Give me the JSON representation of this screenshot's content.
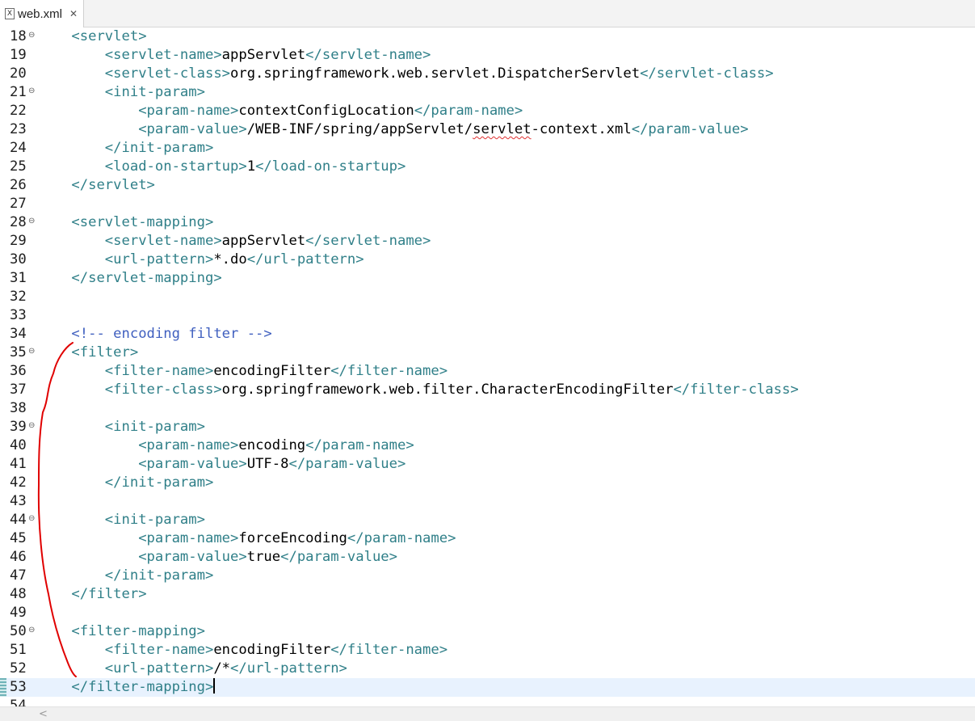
{
  "tab": {
    "filename": "web.xml",
    "icon": "xml-file-icon",
    "close": "✕"
  },
  "editor": {
    "current_line": 53,
    "lines": [
      {
        "n": "18",
        "fold": true,
        "segs": [
          [
            "sp",
            "    "
          ],
          [
            "tag",
            "<servlet>"
          ]
        ]
      },
      {
        "n": "19",
        "segs": [
          [
            "sp",
            "        "
          ],
          [
            "tag",
            "<servlet-name>"
          ],
          [
            "txt",
            "appServlet"
          ],
          [
            "tag",
            "</servlet-name>"
          ]
        ]
      },
      {
        "n": "20",
        "segs": [
          [
            "sp",
            "        "
          ],
          [
            "tag",
            "<servlet-class>"
          ],
          [
            "txt",
            "org.springframework.web.servlet.DispatcherServlet"
          ],
          [
            "tag",
            "</servlet-class>"
          ]
        ]
      },
      {
        "n": "21",
        "fold": true,
        "segs": [
          [
            "sp",
            "        "
          ],
          [
            "tag",
            "<init-param>"
          ]
        ]
      },
      {
        "n": "22",
        "segs": [
          [
            "sp",
            "            "
          ],
          [
            "tag",
            "<param-name>"
          ],
          [
            "txt",
            "contextConfigLocation"
          ],
          [
            "tag",
            "</param-name>"
          ]
        ]
      },
      {
        "n": "23",
        "segs": [
          [
            "sp",
            "            "
          ],
          [
            "tag",
            "<param-value>"
          ],
          [
            "txt",
            "/WEB-INF/spring/appServlet/"
          ],
          [
            "squig",
            "servlet"
          ],
          [
            "txt",
            "-context.xml"
          ],
          [
            "tag",
            "</param-value>"
          ]
        ]
      },
      {
        "n": "24",
        "segs": [
          [
            "sp",
            "        "
          ],
          [
            "tag",
            "</init-param>"
          ]
        ]
      },
      {
        "n": "25",
        "segs": [
          [
            "sp",
            "        "
          ],
          [
            "tag",
            "<load-on-startup>"
          ],
          [
            "txt",
            "1"
          ],
          [
            "tag",
            "</load-on-startup>"
          ]
        ]
      },
      {
        "n": "26",
        "segs": [
          [
            "sp",
            "    "
          ],
          [
            "tag",
            "</servlet>"
          ]
        ]
      },
      {
        "n": "27",
        "segs": []
      },
      {
        "n": "28",
        "fold": true,
        "segs": [
          [
            "sp",
            "    "
          ],
          [
            "tag",
            "<servlet-mapping>"
          ]
        ]
      },
      {
        "n": "29",
        "segs": [
          [
            "sp",
            "        "
          ],
          [
            "tag",
            "<servlet-name>"
          ],
          [
            "txt",
            "appServlet"
          ],
          [
            "tag",
            "</servlet-name>"
          ]
        ]
      },
      {
        "n": "30",
        "segs": [
          [
            "sp",
            "        "
          ],
          [
            "tag",
            "<url-pattern>"
          ],
          [
            "txt",
            "*.do"
          ],
          [
            "tag",
            "</url-pattern>"
          ]
        ]
      },
      {
        "n": "31",
        "segs": [
          [
            "sp",
            "    "
          ],
          [
            "tag",
            "</servlet-mapping>"
          ]
        ]
      },
      {
        "n": "32",
        "segs": []
      },
      {
        "n": "33",
        "segs": []
      },
      {
        "n": "34",
        "segs": [
          [
            "sp",
            "    "
          ],
          [
            "cmt",
            "<!-- encoding filter -->"
          ]
        ]
      },
      {
        "n": "35",
        "fold": true,
        "segs": [
          [
            "sp",
            "    "
          ],
          [
            "tag",
            "<filter>"
          ]
        ]
      },
      {
        "n": "36",
        "segs": [
          [
            "sp",
            "        "
          ],
          [
            "tag",
            "<filter-name>"
          ],
          [
            "txt",
            "encodingFilter"
          ],
          [
            "tag",
            "</filter-name>"
          ]
        ]
      },
      {
        "n": "37",
        "segs": [
          [
            "sp",
            "        "
          ],
          [
            "tag",
            "<filter-class>"
          ],
          [
            "txt",
            "org.springframework.web.filter.CharacterEncodingFilter"
          ],
          [
            "tag",
            "</filter-class>"
          ]
        ]
      },
      {
        "n": "38",
        "segs": []
      },
      {
        "n": "39",
        "fold": true,
        "segs": [
          [
            "sp",
            "        "
          ],
          [
            "tag",
            "<init-param>"
          ]
        ]
      },
      {
        "n": "40",
        "segs": [
          [
            "sp",
            "            "
          ],
          [
            "tag",
            "<param-name>"
          ],
          [
            "txt",
            "encoding"
          ],
          [
            "tag",
            "</param-name>"
          ]
        ]
      },
      {
        "n": "41",
        "segs": [
          [
            "sp",
            "            "
          ],
          [
            "tag",
            "<param-value>"
          ],
          [
            "txt",
            "UTF-8"
          ],
          [
            "tag",
            "</param-value>"
          ]
        ]
      },
      {
        "n": "42",
        "segs": [
          [
            "sp",
            "        "
          ],
          [
            "tag",
            "</init-param>"
          ]
        ]
      },
      {
        "n": "43",
        "segs": []
      },
      {
        "n": "44",
        "fold": true,
        "segs": [
          [
            "sp",
            "        "
          ],
          [
            "tag",
            "<init-param>"
          ]
        ]
      },
      {
        "n": "45",
        "segs": [
          [
            "sp",
            "            "
          ],
          [
            "tag",
            "<param-name>"
          ],
          [
            "txt",
            "forceEncoding"
          ],
          [
            "tag",
            "</param-name>"
          ]
        ]
      },
      {
        "n": "46",
        "segs": [
          [
            "sp",
            "            "
          ],
          [
            "tag",
            "<param-value>"
          ],
          [
            "txt",
            "true"
          ],
          [
            "tag",
            "</param-value>"
          ]
        ]
      },
      {
        "n": "47",
        "segs": [
          [
            "sp",
            "        "
          ],
          [
            "tag",
            "</init-param>"
          ]
        ]
      },
      {
        "n": "48",
        "segs": [
          [
            "sp",
            "    "
          ],
          [
            "tag",
            "</filter>"
          ]
        ]
      },
      {
        "n": "49",
        "segs": []
      },
      {
        "n": "50",
        "fold": true,
        "segs": [
          [
            "sp",
            "    "
          ],
          [
            "tag",
            "<filter-mapping>"
          ]
        ]
      },
      {
        "n": "51",
        "segs": [
          [
            "sp",
            "        "
          ],
          [
            "tag",
            "<filter-name>"
          ],
          [
            "txt",
            "encodingFilter"
          ],
          [
            "tag",
            "</filter-name>"
          ]
        ]
      },
      {
        "n": "52",
        "segs": [
          [
            "sp",
            "        "
          ],
          [
            "tag",
            "<url-pattern>"
          ],
          [
            "txt",
            "/*"
          ],
          [
            "tag",
            "</url-pattern>"
          ]
        ]
      },
      {
        "n": "53",
        "marker": true,
        "caret": true,
        "segs": [
          [
            "sp",
            "    "
          ],
          [
            "tag",
            "</filter-mapping>"
          ]
        ]
      },
      {
        "n": "54",
        "segs": []
      }
    ]
  },
  "colors": {
    "tag": "#2f7f88",
    "text": "#000000",
    "comment": "#3f5fbf",
    "current_line": "#e8f2fe",
    "annotation": "#e00000"
  },
  "scrollbar": {
    "left_arrow": "<"
  }
}
